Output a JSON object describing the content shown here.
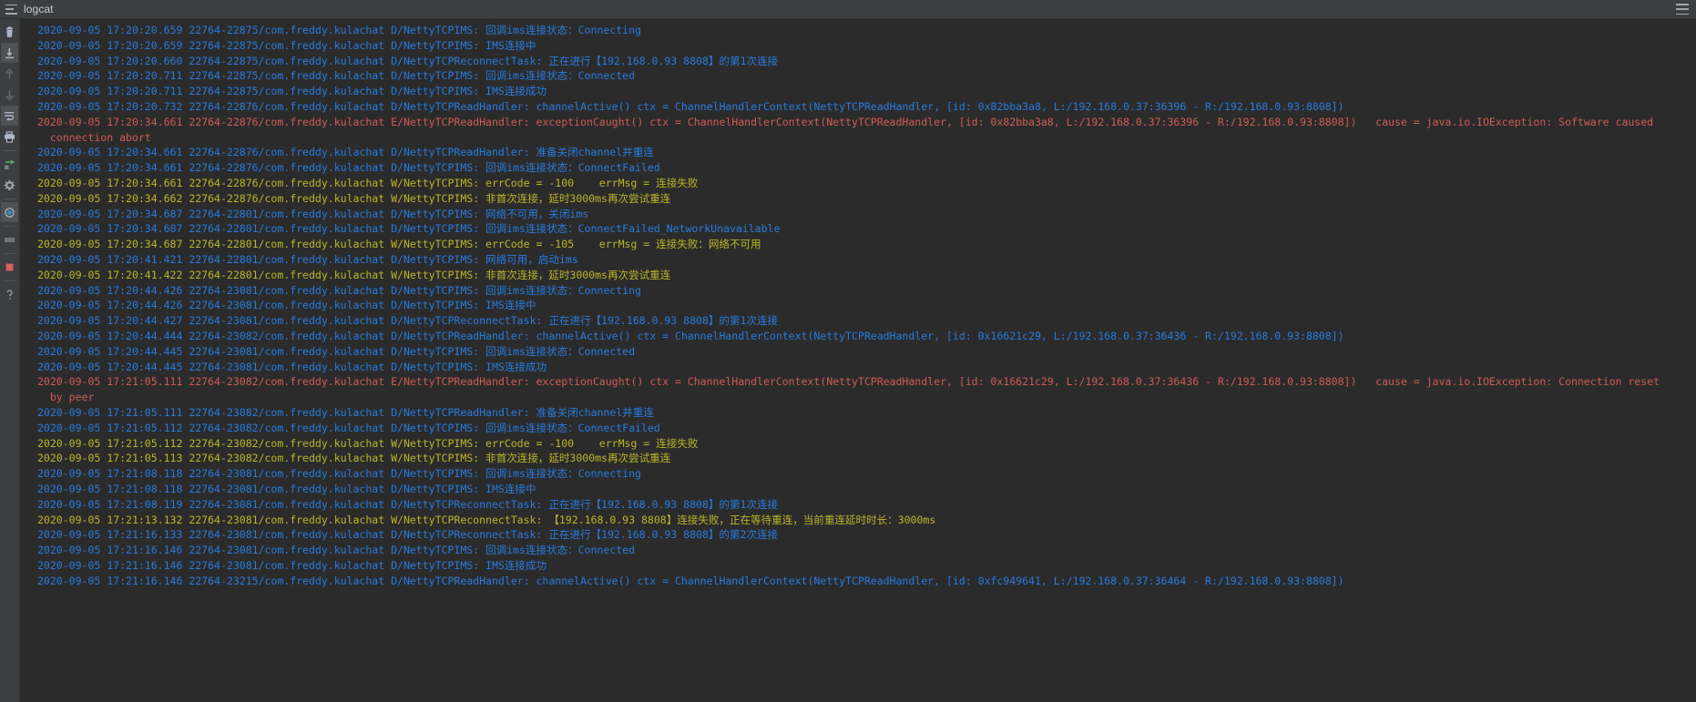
{
  "window": {
    "title": "logcat",
    "menu_icon": "hamburger-menu-icon",
    "options_icon": "window-options-icon"
  },
  "toolbar": {
    "items": [
      {
        "name": "clear-logcat-button",
        "icon": "trash-icon",
        "state": "normal"
      },
      {
        "name": "scroll-to-end-button",
        "icon": "scroll-to-end-icon",
        "state": "selected"
      },
      {
        "name": "up-the-stack-trace-button",
        "icon": "arrow-up-icon",
        "state": "disabled"
      },
      {
        "name": "down-the-stack-trace-button",
        "icon": "arrow-down-icon",
        "state": "disabled"
      },
      {
        "name": "soft-wraps-button",
        "icon": "soft-wrap-icon",
        "state": "selected"
      },
      {
        "name": "print-button",
        "icon": "printer-icon",
        "state": "normal"
      },
      {
        "name": "restart-button",
        "icon": "restart-green-icon",
        "state": "normal"
      },
      {
        "name": "settings-button",
        "icon": "gear-icon",
        "state": "normal"
      },
      {
        "name": "help-button",
        "icon": "help-circle-icon",
        "state": "selected"
      },
      {
        "name": "close-button",
        "icon": "hide-bar-icon",
        "state": "normal"
      },
      {
        "name": "breakpoint-button",
        "icon": "red-square-icon",
        "state": "normal"
      },
      {
        "name": "question-button",
        "icon": "question-mark-icon",
        "state": "normal"
      }
    ]
  },
  "colors": {
    "background": "#2b2b2b",
    "chrome": "#3c3f41",
    "debug": "#287bde",
    "warn": "#bbb529",
    "error": "#cf5b56",
    "title_text": "#c8cdd2"
  },
  "logcat": {
    "lines": [
      {
        "level": "D",
        "text": "2020-09-05 17:20:20.659 22764-22875/com.freddy.kulachat D/NettyTCPIMS: 回调ims连接状态：Connecting"
      },
      {
        "level": "D",
        "text": "2020-09-05 17:20:20.659 22764-22875/com.freddy.kulachat D/NettyTCPIMS: IMS连接中"
      },
      {
        "level": "D",
        "text": "2020-09-05 17:20:20.660 22764-22875/com.freddy.kulachat D/NettyTCPReconnectTask: 正在进行【192.168.0.93 8808】的第1次连接"
      },
      {
        "level": "D",
        "text": "2020-09-05 17:20:20.711 22764-22875/com.freddy.kulachat D/NettyTCPIMS: 回调ims连接状态：Connected"
      },
      {
        "level": "D",
        "text": "2020-09-05 17:20:20.711 22764-22875/com.freddy.kulachat D/NettyTCPIMS: IMS连接成功"
      },
      {
        "level": "D",
        "text": "2020-09-05 17:20:20.732 22764-22876/com.freddy.kulachat D/NettyTCPReadHandler: channelActive() ctx = ChannelHandlerContext(NettyTCPReadHandler, [id: 0x82bba3a8, L:/192.168.0.37:36396 - R:/192.168.0.93:8808])"
      },
      {
        "level": "E",
        "text": "2020-09-05 17:20:34.661 22764-22876/com.freddy.kulachat E/NettyTCPReadHandler: exceptionCaught() ctx = ChannelHandlerContext(NettyTCPReadHandler, [id: 0x82bba3a8, L:/192.168.0.37:36396 - R:/192.168.0.93:8808])   cause = java.io.IOException: Software caused"
      },
      {
        "level": "E",
        "text": "  connection abort",
        "continuation": true
      },
      {
        "level": "D",
        "text": "2020-09-05 17:20:34.661 22764-22876/com.freddy.kulachat D/NettyTCPReadHandler: 准备关闭channel并重连"
      },
      {
        "level": "D",
        "text": "2020-09-05 17:20:34.661 22764-22876/com.freddy.kulachat D/NettyTCPIMS: 回调ims连接状态：ConnectFailed"
      },
      {
        "level": "W",
        "text": "2020-09-05 17:20:34.661 22764-22876/com.freddy.kulachat W/NettyTCPIMS: errCode = -100    errMsg = 连接失败"
      },
      {
        "level": "W",
        "text": "2020-09-05 17:20:34.662 22764-22876/com.freddy.kulachat W/NettyTCPIMS: 非首次连接，延时3000ms再次尝试重连"
      },
      {
        "level": "D",
        "text": "2020-09-05 17:20:34.687 22764-22801/com.freddy.kulachat D/NettyTCPIMS: 网络不可用，关闭ims"
      },
      {
        "level": "D",
        "text": "2020-09-05 17:20:34.687 22764-22801/com.freddy.kulachat D/NettyTCPIMS: 回调ims连接状态：ConnectFailed_NetworkUnavailable"
      },
      {
        "level": "W",
        "text": "2020-09-05 17:20:34.687 22764-22801/com.freddy.kulachat W/NettyTCPIMS: errCode = -105    errMsg = 连接失败：网络不可用"
      },
      {
        "level": "D",
        "text": "2020-09-05 17:20:41.421 22764-22801/com.freddy.kulachat D/NettyTCPIMS: 网络可用，启动ims"
      },
      {
        "level": "W",
        "text": "2020-09-05 17:20:41.422 22764-22801/com.freddy.kulachat W/NettyTCPIMS: 非首次连接，延时3000ms再次尝试重连"
      },
      {
        "level": "D",
        "text": "2020-09-05 17:20:44.426 22764-23081/com.freddy.kulachat D/NettyTCPIMS: 回调ims连接状态：Connecting"
      },
      {
        "level": "D",
        "text": "2020-09-05 17:20:44.426 22764-23081/com.freddy.kulachat D/NettyTCPIMS: IMS连接中"
      },
      {
        "level": "D",
        "text": "2020-09-05 17:20:44.427 22764-23081/com.freddy.kulachat D/NettyTCPReconnectTask: 正在进行【192.168.0.93 8808】的第1次连接"
      },
      {
        "level": "D",
        "text": "2020-09-05 17:20:44.444 22764-23082/com.freddy.kulachat D/NettyTCPReadHandler: channelActive() ctx = ChannelHandlerContext(NettyTCPReadHandler, [id: 0x16621c29, L:/192.168.0.37:36436 - R:/192.168.0.93:8808])"
      },
      {
        "level": "D",
        "text": "2020-09-05 17:20:44.445 22764-23081/com.freddy.kulachat D/NettyTCPIMS: 回调ims连接状态：Connected"
      },
      {
        "level": "D",
        "text": "2020-09-05 17:20:44.445 22764-23081/com.freddy.kulachat D/NettyTCPIMS: IMS连接成功"
      },
      {
        "level": "E",
        "text": "2020-09-05 17:21:05.111 22764-23082/com.freddy.kulachat E/NettyTCPReadHandler: exceptionCaught() ctx = ChannelHandlerContext(NettyTCPReadHandler, [id: 0x16621c29, L:/192.168.0.37:36436 - R:/192.168.0.93:8808])   cause = java.io.IOException: Connection reset"
      },
      {
        "level": "E",
        "text": "  by peer",
        "continuation": true
      },
      {
        "level": "D",
        "text": "2020-09-05 17:21:05.111 22764-23082/com.freddy.kulachat D/NettyTCPReadHandler: 准备关闭channel并重连"
      },
      {
        "level": "D",
        "text": "2020-09-05 17:21:05.112 22764-23082/com.freddy.kulachat D/NettyTCPIMS: 回调ims连接状态：ConnectFailed"
      },
      {
        "level": "W",
        "text": "2020-09-05 17:21:05.112 22764-23082/com.freddy.kulachat W/NettyTCPIMS: errCode = -100    errMsg = 连接失败"
      },
      {
        "level": "W",
        "text": "2020-09-05 17:21:05.113 22764-23082/com.freddy.kulachat W/NettyTCPIMS: 非首次连接，延时3000ms再次尝试重连"
      },
      {
        "level": "D",
        "text": "2020-09-05 17:21:08.118 22764-23081/com.freddy.kulachat D/NettyTCPIMS: 回调ims连接状态：Connecting"
      },
      {
        "level": "D",
        "text": "2020-09-05 17:21:08.118 22764-23081/com.freddy.kulachat D/NettyTCPIMS: IMS连接中"
      },
      {
        "level": "D",
        "text": "2020-09-05 17:21:08.119 22764-23081/com.freddy.kulachat D/NettyTCPReconnectTask: 正在进行【192.168.0.93 8808】的第1次连接"
      },
      {
        "level": "W",
        "text": "2020-09-05 17:21:13.132 22764-23081/com.freddy.kulachat W/NettyTCPReconnectTask: 【192.168.0.93 8808】连接失败，正在等待重连，当前重连延时时长：3000ms"
      },
      {
        "level": "D",
        "text": "2020-09-05 17:21:16.133 22764-23081/com.freddy.kulachat D/NettyTCPReconnectTask: 正在进行【192.168.0.93 8808】的第2次连接"
      },
      {
        "level": "D",
        "text": "2020-09-05 17:21:16.146 22764-23081/com.freddy.kulachat D/NettyTCPIMS: 回调ims连接状态：Connected"
      },
      {
        "level": "D",
        "text": "2020-09-05 17:21:16.146 22764-23081/com.freddy.kulachat D/NettyTCPIMS: IMS连接成功"
      },
      {
        "level": "D",
        "text": "2020-09-05 17:21:16.146 22764-23215/com.freddy.kulachat D/NettyTCPReadHandler: channelActive() ctx = ChannelHandlerContext(NettyTCPReadHandler, [id: 0xfc949641, L:/192.168.0.37:36464 - R:/192.168.0.93:8808])"
      }
    ]
  }
}
